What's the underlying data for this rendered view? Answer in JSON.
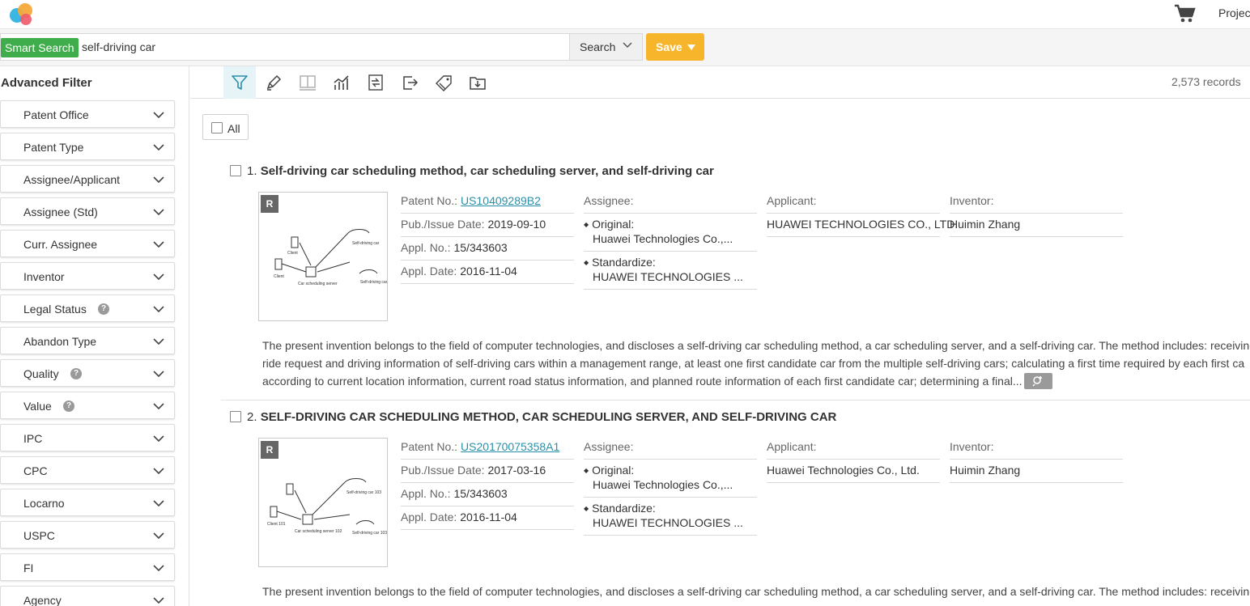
{
  "header": {
    "projects_label": "Projec",
    "icons": [
      "logo-icon",
      "cart-icon"
    ]
  },
  "search": {
    "tag": "Smart Search",
    "query": "self-driving car",
    "button_label": "Search",
    "save_label": "Save"
  },
  "sidebar": {
    "title": "Advanced Filter",
    "items": [
      {
        "label": "Patent Office",
        "help": false
      },
      {
        "label": "Patent Type",
        "help": false
      },
      {
        "label": "Assignee/Applicant",
        "help": false
      },
      {
        "label": "Assignee (Std)",
        "help": false
      },
      {
        "label": "Curr. Assignee",
        "help": false
      },
      {
        "label": "Inventor",
        "help": false
      },
      {
        "label": "Legal Status",
        "help": true
      },
      {
        "label": "Abandon Type",
        "help": false
      },
      {
        "label": "Quality",
        "help": true
      },
      {
        "label": "Value",
        "help": true
      },
      {
        "label": "IPC",
        "help": false
      },
      {
        "label": "CPC",
        "help": false
      },
      {
        "label": "Locarno",
        "help": false
      },
      {
        "label": "USPC",
        "help": false
      },
      {
        "label": "FI",
        "help": false
      },
      {
        "label": "Agency",
        "help": false
      }
    ]
  },
  "toolbar": {
    "tools": [
      "filter-icon",
      "highlight-icon",
      "split-view-icon",
      "analytics-icon",
      "compare-icon",
      "export-icon",
      "tag-icon",
      "save-to-folder-icon"
    ],
    "records": "2,573 records",
    "select_all_label": "All"
  },
  "results": [
    {
      "num": "1.",
      "title": "Self-driving car scheduling method, car scheduling server, and self-driving car",
      "badge": "R",
      "patent_no_label": "Patent No.:",
      "patent_no": "US10409289B2",
      "pub_date_label": "Pub./Issue Date:",
      "pub_date": "2019-09-10",
      "appl_no_label": "Appl. No.:",
      "appl_no": "15/343603",
      "appl_date_label": "Appl. Date:",
      "appl_date": "2016-11-04",
      "assignee_label": "Assignee:",
      "original_label": "Original:",
      "original": "Huawei Technologies Co.,...",
      "standardize_label": "Standardize:",
      "standardize": "HUAWEI TECHNOLOGIES ...",
      "applicant_label": "Applicant:",
      "applicant": "HUAWEI TECHNOLOGIES CO., LTD.",
      "inventor_label": "Inventor:",
      "inventor": "Huimin Zhang",
      "abstract_lines": [
        "The present invention belongs to the field of computer technologies, and discloses a self-driving car scheduling method, a car scheduling server, and a self-driving car. The method includes: receiving",
        "ride request and driving information of self-driving cars within a management range, at least one first candidate car from the multiple self-driving cars; calculating a first time required by each first ca",
        "according to current location information, current road status information, and planned route information of each first candidate car; determining a final..."
      ]
    },
    {
      "num": "2.",
      "title": "SELF-DRIVING CAR SCHEDULING METHOD, CAR SCHEDULING SERVER, AND SELF-DRIVING CAR",
      "badge": "R",
      "patent_no_label": "Patent No.:",
      "patent_no": "US20170075358A1",
      "pub_date_label": "Pub./Issue Date:",
      "pub_date": "2017-03-16",
      "appl_no_label": "Appl. No.:",
      "appl_no": "15/343603",
      "appl_date_label": "Appl. Date:",
      "appl_date": "2016-11-04",
      "assignee_label": "Assignee:",
      "original_label": "Original:",
      "original": "Huawei Technologies Co.,...",
      "standardize_label": "Standardize:",
      "standardize": "HUAWEI TECHNOLOGIES ...",
      "applicant_label": "Applicant:",
      "applicant": "Huawei Technologies Co., Ltd.",
      "inventor_label": "Inventor:",
      "inventor": "Huimin Zhang",
      "abstract_lines": [
        "The present invention belongs to the field of computer technologies, and discloses a self-driving car scheduling method, a car scheduling server, and a self-driving car. The method includes: receiving"
      ]
    }
  ]
}
